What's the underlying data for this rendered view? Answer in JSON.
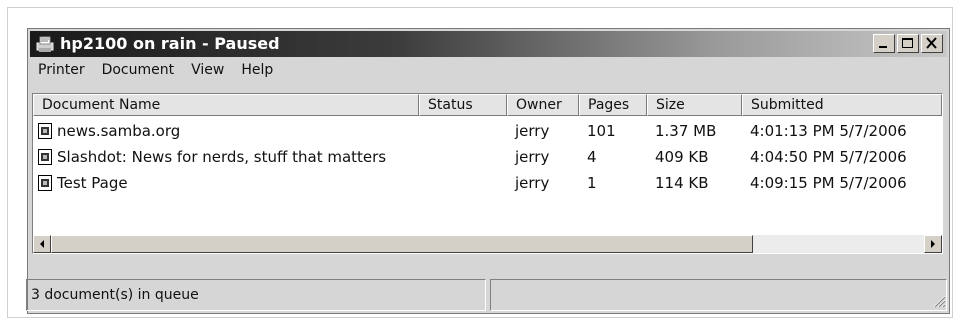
{
  "window": {
    "title": "hp2100 on rain - Paused",
    "buttons": [
      "minimize",
      "maximize",
      "close"
    ]
  },
  "menu": [
    "Printer",
    "Document",
    "View",
    "Help"
  ],
  "columns": [
    "Document Name",
    "Status",
    "Owner",
    "Pages",
    "Size",
    "Submitted"
  ],
  "rows": [
    {
      "name": "news.samba.org",
      "status": "",
      "owner": "jerry",
      "pages": "101",
      "size": "1.37 MB",
      "submitted": "4:01:13 PM  5/7/2006"
    },
    {
      "name": "Slashdot: News for nerds, stuff that matters",
      "status": "",
      "owner": "jerry",
      "pages": "4",
      "size": "409 KB",
      "submitted": "4:04:50 PM  5/7/2006"
    },
    {
      "name": "Test Page",
      "status": "",
      "owner": "jerry",
      "pages": "1",
      "size": "114 KB",
      "submitted": "4:09:15 PM  5/7/2006"
    }
  ],
  "statusbar": {
    "text": "3 document(s) in queue"
  },
  "icons": {
    "title": "printer-icon",
    "document": "document-icon"
  }
}
